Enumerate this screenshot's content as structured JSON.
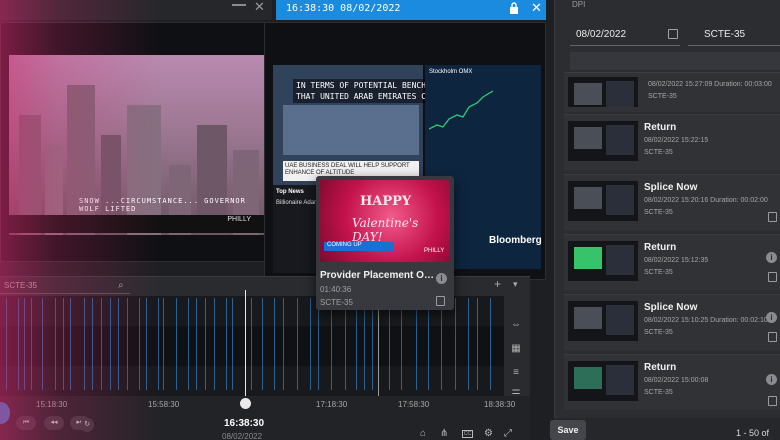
{
  "viewer": {
    "timestamp": "16:38:30 08/02/2022",
    "panel1": {
      "caption": "SNOW ...CIRCUMSTANCE... GOVERNOR WOLF LIFTED",
      "ticker_station": "PHILLY"
    },
    "panel2": {
      "cc_text": "IN TERMS OF POTENTIAL BENCHMARKS THAT UNITED ARAB EMIRATES CAN",
      "lower_third": "UAE BUSINESS DEAL WILL HELP SUPPORT ENHANCE OF ALTITUDE",
      "top_news_label": "Top News",
      "headline": "Billionaire Adani's Fortunes Buying Mumbai Debut",
      "market_label": "Stockholm OMX",
      "brand": "Bloomberg"
    }
  },
  "hover_card": {
    "thumb_text_1": "HAPPY",
    "thumb_text_2": "Valentine's DAY!",
    "thumb_banner": "COMING UP",
    "thumb_station": "PHILLY",
    "title": "Provider Placement Oppor...",
    "duration": "01:40:36",
    "type": "SCTE-35"
  },
  "timeline": {
    "filter_label": "SCTE-35",
    "ticks": [
      "15:18:30",
      "15:58:30",
      "17:18:30",
      "17:58:30",
      "18:38:30"
    ],
    "current_time": "16:38:30",
    "current_date": "08/02/2022",
    "markers": [
      6,
      18,
      24,
      31,
      42,
      55,
      63,
      70,
      84,
      92,
      101,
      110,
      118,
      127,
      139,
      146,
      158,
      163,
      176,
      188,
      196,
      205,
      214,
      226,
      232,
      251,
      262,
      274,
      283,
      297,
      310,
      318,
      331,
      345,
      356,
      364,
      372,
      389,
      401,
      416,
      428,
      441,
      455,
      468,
      477,
      490
    ]
  },
  "sidebar": {
    "header": "DPI",
    "date": "08/02/2022",
    "type_filter": "SCTE-35",
    "items": [
      {
        "name": "",
        "meta": "08/02/2022 15:27:09 Duration: 00:03:00",
        "type": "SCTE-35"
      },
      {
        "name": "Return",
        "meta": "08/02/2022 15:22:15",
        "type": "SCTE-35"
      },
      {
        "name": "Splice Now",
        "meta": "08/02/2022 15:20:16 Duration: 00:02:00",
        "type": "SCTE-35"
      },
      {
        "name": "Return",
        "meta": "08/02/2022 15:12:35",
        "type": "SCTE-35"
      },
      {
        "name": "Splice Now",
        "meta": "08/02/2022 15:10:25 Duration: 00:02:10",
        "type": "SCTE-35"
      },
      {
        "name": "Return",
        "meta": "08/02/2022 15:00:08",
        "type": "SCTE-35"
      }
    ],
    "save_label": "Save",
    "paging": "1 - 50 of"
  }
}
